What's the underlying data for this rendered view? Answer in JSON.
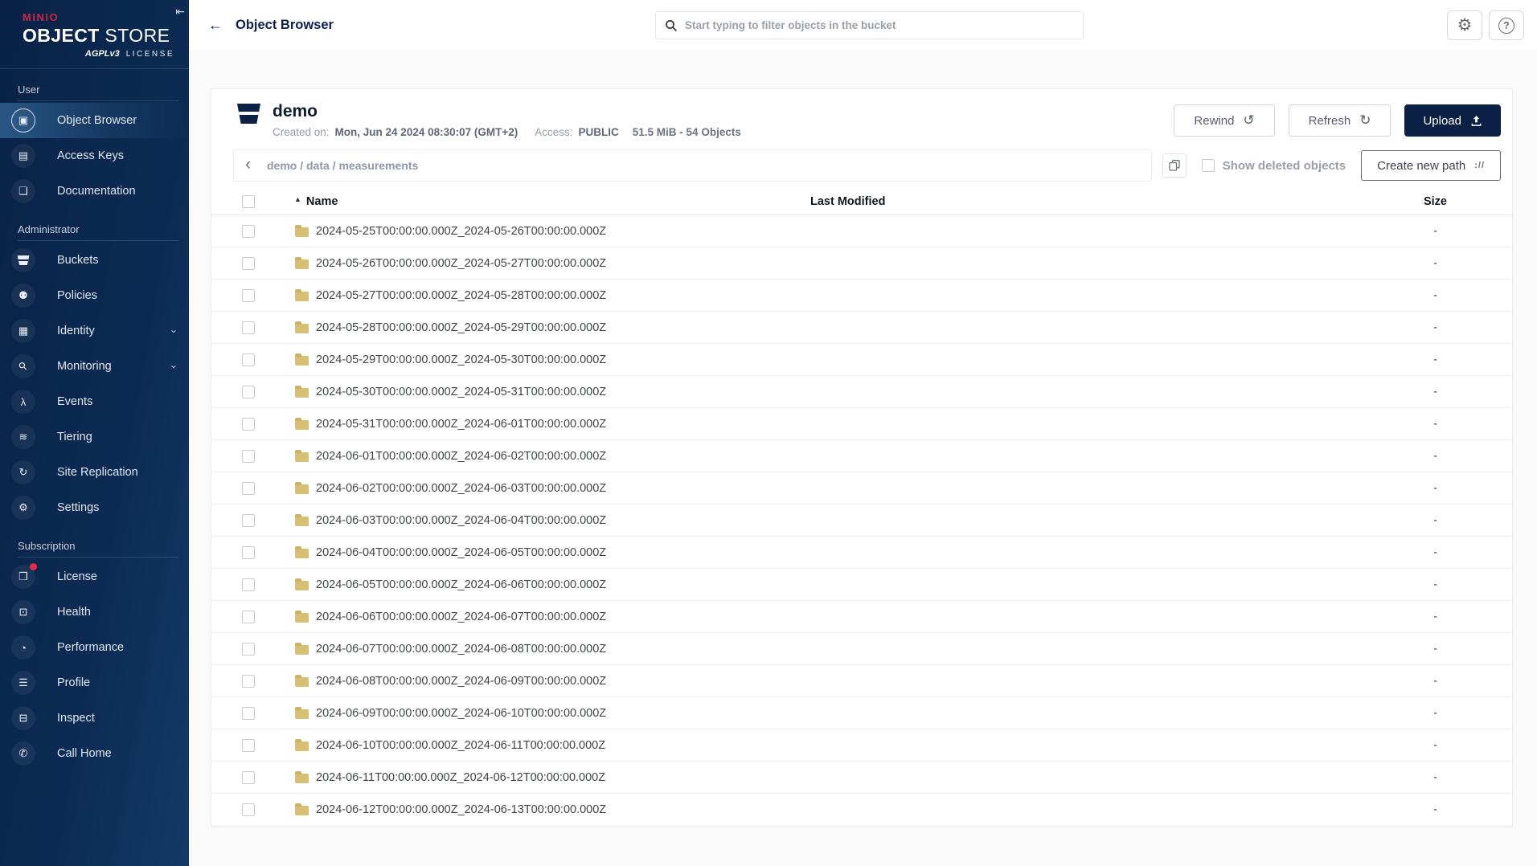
{
  "sidebar": {
    "collapse_icon": "⇤",
    "logo": {
      "brand": "MINIO",
      "title_bold": "OBJECT",
      "title_light": "STORE",
      "license_badge": "AGPLv3",
      "license_label": "LICENSE"
    },
    "sections": [
      {
        "label": "User",
        "items": [
          {
            "label": "Object Browser",
            "icon": "object-browser-icon",
            "glyph": "▣",
            "selected": true
          },
          {
            "label": "Access Keys",
            "icon": "access-keys-icon",
            "glyph": "▤"
          },
          {
            "label": "Documentation",
            "icon": "documentation-icon",
            "glyph": "❏"
          }
        ]
      },
      {
        "label": "Administrator",
        "items": [
          {
            "label": "Buckets",
            "icon": "buckets-icon",
            "glyph": ""
          },
          {
            "label": "Policies",
            "icon": "policies-icon",
            "glyph": "⚉"
          },
          {
            "label": "Identity",
            "icon": "identity-icon",
            "glyph": "▦",
            "expandable": true
          },
          {
            "label": "Monitoring",
            "icon": "monitoring-icon",
            "glyph": "⚲",
            "magnifier": true,
            "expandable": true
          },
          {
            "label": "Events",
            "icon": "events-icon",
            "glyph": "λ"
          },
          {
            "label": "Tiering",
            "icon": "tiering-icon",
            "glyph": "≋"
          },
          {
            "label": "Site Replication",
            "icon": "site-replication-icon",
            "glyph": "↻"
          },
          {
            "label": "Settings",
            "icon": "settings-icon",
            "glyph": "⚙"
          }
        ]
      },
      {
        "label": "Subscription",
        "items": [
          {
            "label": "License",
            "icon": "license-icon",
            "glyph": "❒",
            "badge": true
          },
          {
            "label": "Health",
            "icon": "health-icon",
            "glyph": "⊡"
          },
          {
            "label": "Performance",
            "icon": "performance-icon",
            "glyph": "◔"
          },
          {
            "label": "Profile",
            "icon": "profile-icon",
            "glyph": "☰"
          },
          {
            "label": "Inspect",
            "icon": "inspect-icon",
            "glyph": "⊟"
          },
          {
            "label": "Call Home",
            "icon": "call-home-icon",
            "glyph": "✆"
          }
        ]
      }
    ]
  },
  "header": {
    "back_icon": "←",
    "title": "Object Browser",
    "search_placeholder": "Start typing to filter objects in the bucket"
  },
  "bucket": {
    "name": "demo",
    "created_label": "Created on:",
    "created_value": "Mon, Jun 24 2024 08:30:07 (GMT+2)",
    "access_label": "Access:",
    "access_value": "PUBLIC",
    "usage": "51.5 MiB - 54 Objects",
    "actions": {
      "rewind": "Rewind",
      "rewind_icon": "↺",
      "refresh": "Refresh",
      "refresh_icon": "↻",
      "upload": "Upload"
    }
  },
  "toolbar": {
    "back_icon": "‹",
    "breadcrumb": "demo / data / measurements",
    "show_deleted_label": "Show deleted objects",
    "create_path_label": "Create new path",
    "create_path_icon": "://"
  },
  "table": {
    "sort_icon": "▲",
    "columns": {
      "name": "Name",
      "last_modified": "Last Modified",
      "size": "Size"
    },
    "rows": [
      {
        "name": "2024-05-25T00:00:00.000Z_2024-05-26T00:00:00.000Z",
        "last_modified": "",
        "size": "-"
      },
      {
        "name": "2024-05-26T00:00:00.000Z_2024-05-27T00:00:00.000Z",
        "last_modified": "",
        "size": "-"
      },
      {
        "name": "2024-05-27T00:00:00.000Z_2024-05-28T00:00:00.000Z",
        "last_modified": "",
        "size": "-"
      },
      {
        "name": "2024-05-28T00:00:00.000Z_2024-05-29T00:00:00.000Z",
        "last_modified": "",
        "size": "-"
      },
      {
        "name": "2024-05-29T00:00:00.000Z_2024-05-30T00:00:00.000Z",
        "last_modified": "",
        "size": "-"
      },
      {
        "name": "2024-05-30T00:00:00.000Z_2024-05-31T00:00:00.000Z",
        "last_modified": "",
        "size": "-"
      },
      {
        "name": "2024-05-31T00:00:00.000Z_2024-06-01T00:00:00.000Z",
        "last_modified": "",
        "size": "-"
      },
      {
        "name": "2024-06-01T00:00:00.000Z_2024-06-02T00:00:00.000Z",
        "last_modified": "",
        "size": "-"
      },
      {
        "name": "2024-06-02T00:00:00.000Z_2024-06-03T00:00:00.000Z",
        "last_modified": "",
        "size": "-"
      },
      {
        "name": "2024-06-03T00:00:00.000Z_2024-06-04T00:00:00.000Z",
        "last_modified": "",
        "size": "-"
      },
      {
        "name": "2024-06-04T00:00:00.000Z_2024-06-05T00:00:00.000Z",
        "last_modified": "",
        "size": "-"
      },
      {
        "name": "2024-06-05T00:00:00.000Z_2024-06-06T00:00:00.000Z",
        "last_modified": "",
        "size": "-"
      },
      {
        "name": "2024-06-06T00:00:00.000Z_2024-06-07T00:00:00.000Z",
        "last_modified": "",
        "size": "-"
      },
      {
        "name": "2024-06-07T00:00:00.000Z_2024-06-08T00:00:00.000Z",
        "last_modified": "",
        "size": "-"
      },
      {
        "name": "2024-06-08T00:00:00.000Z_2024-06-09T00:00:00.000Z",
        "last_modified": "",
        "size": "-"
      },
      {
        "name": "2024-06-09T00:00:00.000Z_2024-06-10T00:00:00.000Z",
        "last_modified": "",
        "size": "-"
      },
      {
        "name": "2024-06-10T00:00:00.000Z_2024-06-11T00:00:00.000Z",
        "last_modified": "",
        "size": "-"
      },
      {
        "name": "2024-06-11T00:00:00.000Z_2024-06-12T00:00:00.000Z",
        "last_modified": "",
        "size": "-"
      },
      {
        "name": "2024-06-12T00:00:00.000Z_2024-06-13T00:00:00.000Z",
        "last_modified": "",
        "size": "-"
      }
    ]
  }
}
